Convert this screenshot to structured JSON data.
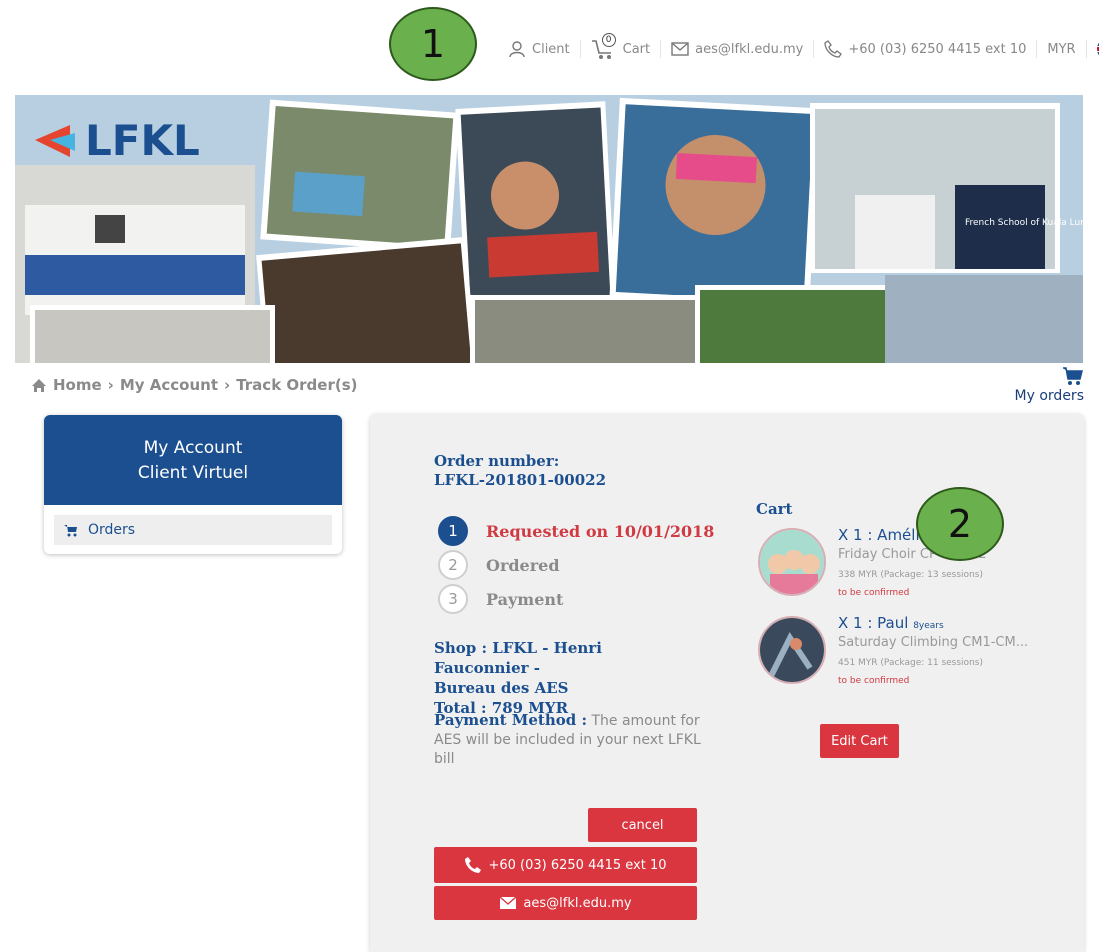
{
  "topbar": {
    "client_label": "Client",
    "cart_count": "0",
    "cart_label": "Cart",
    "email": "aes@lfkl.edu.my",
    "phone": "+60 (03) 6250 4415 ext 10",
    "currency": "MYR"
  },
  "markers": {
    "one": "1",
    "two": "2"
  },
  "breadcrumb": {
    "home": "Home",
    "account": "My Account",
    "track": "Track Order(s)"
  },
  "my_orders_label": "My orders",
  "account_panel": {
    "title": "My Account",
    "subtitle": "Client Virtuel",
    "orders_label": "Orders"
  },
  "order": {
    "number_label": "Order number:",
    "number": "LFKL-201801-00022",
    "steps": [
      {
        "num": "1",
        "label": "Requested on 10/01/2018"
      },
      {
        "num": "2",
        "label": "Ordered"
      },
      {
        "num": "3",
        "label": "Payment"
      }
    ],
    "shop_line1": "Shop : LFKL - Henri Fauconnier -",
    "shop_line2": "Bureau des AES",
    "total": "Total : 789 MYR",
    "payment_label": "Payment Method :",
    "payment_text": " The amount for AES will be included in your next LFKL bill",
    "cancel_label": "cancel",
    "phone_button": "+60 (03) 6250 4415 ext  10",
    "email_button": "aes@lfkl.edu.my"
  },
  "cart": {
    "title": "Cart",
    "items": [
      {
        "title": "X 1 : Amélie",
        "age": "",
        "activity": "Friday Choir CP to CM2",
        "price": "338 MYR (Package: 13 sessions)",
        "status": "to be confirmed"
      },
      {
        "title": "X 1 : Paul",
        "age": "8years",
        "activity": "Saturday Climbing CM1-CM...",
        "price": "451 MYR (Package: 11 sessions)",
        "status": "to be confirmed"
      }
    ],
    "edit_label": "Edit Cart"
  },
  "colors": {
    "brand_blue": "#1b4f8f",
    "accent_red": "#d93640",
    "marker_green": "#6ab04c"
  },
  "banner": {
    "logo_text": "LFKL",
    "shirt_text": "French School of Kuala Lumpur"
  }
}
